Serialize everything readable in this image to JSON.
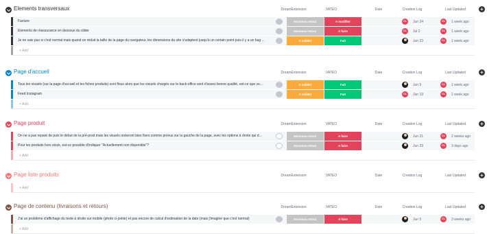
{
  "columns": {
    "dream": "DreamExtension",
    "vateo": "VATEO",
    "date": "Date",
    "clog": "Creation Log",
    "updated": "Last Updated"
  },
  "add_item_label": "+ Add",
  "add_column_label": "+",
  "colors": {
    "neutral": "#c4c4c4",
    "orange": "#fdab3d",
    "green": "#00c875",
    "red": "#e2445c"
  },
  "groups": [
    {
      "title": "Elements transversaux",
      "color": "#333333",
      "rows": [
        {
          "name": "Facture",
          "color": "#333333",
          "bubble": "gray",
          "dream": "Nouveau retour",
          "dream_color": "#c4c4c4",
          "vateo": "A modifier",
          "vateo_color": "#e2445c",
          "av1": "CL",
          "av1_color": "#e2445c",
          "av1_dark": false,
          "date1": "Jun 24",
          "av2": "CL",
          "av2_color": "#e2445c",
          "date2": "1 week ago"
        },
        {
          "name": "Elements de réassurance en dessous du slider",
          "color": "#333333",
          "bubble": "gray",
          "dream": "Nouveau retour",
          "dream_color": "#c4c4c4",
          "vateo": "A faire",
          "vateo_color": "#e2445c",
          "av1": "CL",
          "av1_color": "#e2445c",
          "av1_dark": false,
          "date1": "Jul 2",
          "av2": "CL",
          "av2_color": "#e2445c",
          "date2": "1 week ago"
        },
        {
          "name": "Je ne sais pas si c'est normal mais quand on réduit la taille de la page du navigateur, les dimensions du site s'adaptent jusqu'à un certain point puis il y a un bug ...",
          "color": "#333333",
          "bubble": "gray",
          "dream": "A valider",
          "dream_color": "#fdab3d",
          "vateo": "Fait",
          "vateo_color": "#00c875",
          "av1": "",
          "av1_color": "#1f1f1f",
          "av1_dark": true,
          "date1": "Jun 23",
          "av2": "CL",
          "av2_color": "#e2445c",
          "date2": "1 week ago"
        }
      ]
    },
    {
      "title": "Page d'accueil",
      "color": "#0086c0",
      "rows": [
        {
          "name": "Tous les visuels (sur la page d'accueil et les fiches produits) sont flous alors que les visuels chargés sur le back-office sont d'assez bonne qualité, est-ce que vo...",
          "color": "#0086c0",
          "bubble": "gray",
          "dream": "A valider",
          "dream_color": "#fdab3d",
          "vateo": "Fait",
          "vateo_color": "#00c875",
          "av1": "",
          "av1_color": "#1f1f1f",
          "av1_dark": true,
          "date1": "Jun 5",
          "av2": "CL",
          "av2_color": "#e2445c",
          "date2": "1 week ago"
        },
        {
          "name": "Feed Instagram",
          "color": "#0086c0",
          "bubble": "gray",
          "dream": "A valider",
          "dream_color": "#fdab3d",
          "vateo": "Fait",
          "vateo_color": "#00c875",
          "av1": "CL",
          "av1_color": "#e2445c",
          "av1_dark": false,
          "date1": "Jun 19",
          "av2": "CL",
          "av2_color": "#e2445c",
          "date2": "1 week ago"
        }
      ]
    },
    {
      "title": "Page produit",
      "color": "#e2445c",
      "rows": [
        {
          "name": "On ne a pas reparé de puis le début de la pré-prod mais les visuels resteront bien fixes comme prévus sur la gauche de la page, avec les options à droite qui d...",
          "color": "#e2445c",
          "bubble": "outline",
          "dream": "Nouveau retour",
          "dream_color": "#c4c4c4",
          "vateo": "A faire",
          "vateo_color": "#e2445c",
          "av1": "",
          "av1_color": "#1f1f1f",
          "av1_dark": true,
          "date1": "Jun 21",
          "av2": "CL",
          "av2_color": "#e2445c",
          "date2": "2 weeks ago"
        },
        {
          "name": "Pour les produits hors stock, est-ce possible d'indiquer \"Actuellement non disponible\"?",
          "color": "#e2445c",
          "bubble": "outline",
          "dream": "Nouveau retour",
          "dream_color": "#c4c4c4",
          "vateo": "A faire",
          "vateo_color": "#e2445c",
          "av1": "",
          "av1_color": "#1f1f1f",
          "av1_dark": true,
          "date1": "Jun 29",
          "av2": "CL",
          "av2_color": "#e2445c",
          "date2": "3 days ago"
        }
      ]
    },
    {
      "title": "Page liste produits",
      "color": "#ff7575",
      "rows": []
    },
    {
      "title": "Page de contenu (livraisons et retours)",
      "color": "#7f5347",
      "rows": [
        {
          "name": "J'ai un problème d'affichage du texte à droite sur mobile (photo ci-jointe) et pas encore de calcul d'estimation de la date (mais j'imagine que c'est normal)",
          "color": "#7f5347",
          "bubble": "gray",
          "dream": "Nouveau retour",
          "dream_color": "#c4c4c4",
          "vateo": "A faire",
          "vateo_color": "#e2445c",
          "av1": "",
          "av1_color": "#1f1f1f",
          "av1_dark": true,
          "date1": "Jun 5",
          "av2": "CL",
          "av2_color": "#e2445c",
          "date2": "3 weeks ago"
        }
      ]
    }
  ]
}
